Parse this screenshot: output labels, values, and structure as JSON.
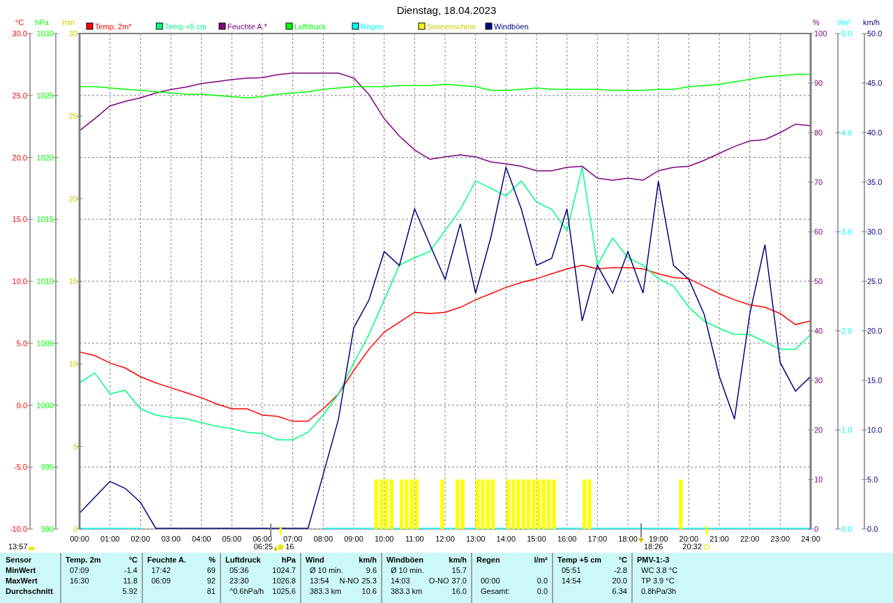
{
  "title": "Dienstag, 18.04.2023",
  "plots": [
    {
      "chart_data": {
        "type": "line",
        "ylabel": "°C",
        "xlim": [
          0,
          1440
        ],
        "ylim": [
          -10,
          30
        ],
        "x": [
          0,
          30,
          60,
          90,
          120,
          150,
          180,
          210,
          240,
          270,
          300,
          330,
          360,
          390,
          420,
          450,
          480,
          510,
          540,
          570,
          600,
          630,
          660,
          690,
          720,
          750,
          780,
          810,
          840,
          870,
          900,
          930,
          960,
          990,
          1020,
          1050,
          1080,
          1110,
          1140,
          1170,
          1200,
          1230,
          1260,
          1290,
          1320,
          1350,
          1380,
          1410,
          1440
        ],
        "xticks": [
          {
            "value": 0,
            "label": "00:00"
          },
          {
            "value": 60,
            "label": "01:00"
          },
          {
            "value": 120,
            "label": "02:00"
          },
          {
            "value": 180,
            "label": "03:00"
          },
          {
            "value": 240,
            "label": "04:00"
          },
          {
            "value": 300,
            "label": "05:00"
          },
          {
            "value": 360,
            "label": "06:00"
          },
          {
            "value": 420,
            "label": "07:00"
          },
          {
            "value": 480,
            "label": "08:00"
          },
          {
            "value": 540,
            "label": "09:00"
          },
          {
            "value": 600,
            "label": "10:00"
          },
          {
            "value": 660,
            "label": "11:00"
          },
          {
            "value": 720,
            "label": "12:00"
          },
          {
            "value": 780,
            "label": "13:00"
          },
          {
            "value": 840,
            "label": "14:00"
          },
          {
            "value": 900,
            "label": "15:00"
          },
          {
            "value": 960,
            "label": "16:00"
          },
          {
            "value": 1020,
            "label": "17:00"
          },
          {
            "value": 1080,
            "label": "18:00"
          },
          {
            "value": 1140,
            "label": "19:00"
          },
          {
            "value": 1200,
            "label": "20:00"
          },
          {
            "value": 1260,
            "label": "21:00"
          },
          {
            "value": 1320,
            "label": "22:00"
          },
          {
            "value": 1380,
            "label": "23:00"
          },
          {
            "value": 1440,
            "label": "24:00"
          }
        ],
        "yticks": [
          {
            "value": 30,
            "label": "30.0"
          },
          {
            "value": 25,
            "label": "25.0"
          },
          {
            "value": 20,
            "label": "20.0"
          },
          {
            "value": 15,
            "label": "15.0"
          },
          {
            "value": 10,
            "label": "10.0"
          },
          {
            "value": 5,
            "label": "5.0"
          },
          {
            "value": 0,
            "label": "0.0"
          },
          {
            "value": -5,
            "label": "-5.0"
          },
          {
            "value": -10,
            "label": "-10.0"
          }
        ],
        "series": [
          {
            "name": "Temp. 2m*",
            "color": "#ff0000",
            "values": [
              4.3,
              4.0,
              3.4,
              3.0,
              2.3,
              1.8,
              1.4,
              1.0,
              0.6,
              0.1,
              -0.3,
              -0.3,
              -0.8,
              -0.9,
              -1.3,
              -1.3,
              -0.3,
              0.9,
              2.8,
              4.5,
              5.9,
              6.7,
              7.5,
              7.4,
              7.5,
              7.9,
              8.5,
              9.0,
              9.5,
              9.9,
              10.2,
              10.6,
              11.0,
              11.3,
              11.0,
              11.1,
              11.1,
              11.0,
              10.6,
              10.3,
              10.2,
              9.6,
              9.0,
              8.5,
              8.1,
              7.9,
              7.4,
              6.5,
              6.8
            ]
          },
          {
            "name": "Temp +5 cm",
            "color": "#00ff80",
            "values": [
              1.8,
              2.6,
              0.9,
              1.2,
              -0.3,
              -0.8,
              -1.0,
              -1.1,
              -1.4,
              -1.7,
              -1.9,
              -2.2,
              -2.3,
              -2.8,
              -2.8,
              -2.2,
              -0.8,
              0.9,
              3.4,
              5.7,
              8.5,
              11.3,
              11.9,
              12.4,
              14.1,
              15.8,
              18.1,
              17.5,
              16.9,
              18.1,
              16.4,
              15.8,
              14.1,
              19.2,
              11.3,
              13.5,
              11.9,
              11.3,
              10.2,
              9.6,
              7.9,
              6.8,
              6.2,
              5.7,
              5.7,
              5.1,
              4.5,
              4.5,
              5.7
            ]
          }
        ]
      }
    },
    {
      "chart_data": {
        "type": "line",
        "ylabel": "%",
        "xlim": [
          0,
          1440
        ],
        "ylim": [
          0,
          100
        ],
        "x": [
          0,
          30,
          60,
          90,
          120,
          150,
          180,
          210,
          240,
          270,
          300,
          330,
          360,
          390,
          420,
          450,
          480,
          510,
          540,
          570,
          600,
          630,
          660,
          690,
          720,
          750,
          780,
          810,
          840,
          870,
          900,
          930,
          960,
          990,
          1020,
          1050,
          1080,
          1110,
          1140,
          1170,
          1200,
          1230,
          1260,
          1290,
          1320,
          1350,
          1380,
          1410,
          1440
        ],
        "yticks": [
          {
            "value": 100,
            "label": "100"
          },
          {
            "value": 90,
            "label": "90"
          },
          {
            "value": 80,
            "label": "80"
          },
          {
            "value": 70,
            "label": "70"
          },
          {
            "value": 60,
            "label": "60"
          },
          {
            "value": 50,
            "label": "50"
          },
          {
            "value": 40,
            "label": "40"
          },
          {
            "value": 30,
            "label": "30"
          },
          {
            "value": 20,
            "label": "20"
          },
          {
            "value": 10,
            "label": "10"
          },
          {
            "value": 0,
            "label": "0"
          }
        ],
        "series": [
          {
            "name": "Feuchte A.*",
            "color": "#800080",
            "values": [
              80.4,
              82.8,
              85.4,
              86.3,
              87.0,
              88.0,
              88.7,
              89.2,
              89.9,
              90.3,
              90.7,
              91.0,
              91.1,
              91.7,
              92.0,
              92.0,
              92.0,
              92.0,
              91.0,
              87.7,
              82.8,
              79.3,
              76.5,
              74.6,
              75.1,
              75.5,
              75.1,
              74.1,
              73.7,
              73.2,
              72.3,
              72.3,
              73.0,
              73.2,
              70.8,
              70.4,
              70.8,
              70.4,
              72.3,
              73.0,
              73.2,
              74.4,
              75.8,
              77.2,
              78.3,
              78.6,
              80.0,
              81.7,
              81.4
            ]
          }
        ]
      }
    },
    {
      "chart_data": {
        "type": "line",
        "ylabel": "hPa",
        "xlim": [
          0,
          1440
        ],
        "ylim": [
          990,
          1030
        ],
        "x": [
          0,
          30,
          60,
          90,
          120,
          150,
          180,
          210,
          240,
          270,
          300,
          330,
          360,
          390,
          420,
          450,
          480,
          510,
          540,
          570,
          600,
          630,
          660,
          690,
          720,
          750,
          780,
          810,
          840,
          870,
          900,
          930,
          960,
          990,
          1020,
          1050,
          1080,
          1110,
          1140,
          1170,
          1200,
          1230,
          1260,
          1290,
          1320,
          1350,
          1380,
          1410,
          1440
        ],
        "yticks": [
          {
            "value": 1030,
            "label": "1030"
          },
          {
            "value": 1025,
            "label": "1025"
          },
          {
            "value": 1020,
            "label": "1020"
          },
          {
            "value": 1015,
            "label": "1015"
          },
          {
            "value": 1010,
            "label": "1010"
          },
          {
            "value": 1005,
            "label": "1005"
          },
          {
            "value": 1000,
            "label": "1000"
          },
          {
            "value": 995,
            "label": "995"
          },
          {
            "value": 990,
            "label": "990"
          }
        ],
        "series": [
          {
            "name": "Luftdruck",
            "color": "#00ff00",
            "values": [
              1025.7,
              1025.7,
              1025.6,
              1025.5,
              1025.4,
              1025.3,
              1025.2,
              1025.1,
              1025.1,
              1025.0,
              1024.9,
              1024.8,
              1024.9,
              1025.1,
              1025.2,
              1025.3,
              1025.5,
              1025.6,
              1025.7,
              1025.7,
              1025.7,
              1025.8,
              1025.8,
              1025.8,
              1025.9,
              1025.8,
              1025.7,
              1025.4,
              1025.4,
              1025.5,
              1025.6,
              1025.5,
              1025.5,
              1025.5,
              1025.5,
              1025.4,
              1025.4,
              1025.4,
              1025.5,
              1025.5,
              1025.7,
              1025.8,
              1025.9,
              1026.1,
              1026.3,
              1026.5,
              1026.6,
              1026.7,
              1026.7
            ]
          }
        ]
      }
    },
    {
      "chart_data": {
        "type": "line",
        "ylabel": "l/m²",
        "xlim": [
          0,
          1440
        ],
        "ylim": [
          0,
          5
        ],
        "x": [
          0,
          30,
          60,
          90,
          120,
          480,
          510,
          540,
          570,
          600,
          630,
          660,
          690,
          720,
          750,
          780,
          810,
          840,
          870,
          900,
          930,
          960,
          990,
          1020,
          1050,
          1080,
          1110,
          1140,
          1170,
          1200,
          1230,
          1260,
          1290,
          1320,
          1350,
          1380,
          1410,
          1440
        ],
        "yticks": [
          {
            "value": 5,
            "label": "5.0"
          },
          {
            "value": 4,
            "label": "4.0"
          },
          {
            "value": 3,
            "label": "3.0"
          },
          {
            "value": 2,
            "label": "2.0"
          },
          {
            "value": 1,
            "label": "1.0"
          },
          {
            "value": 0,
            "label": "0.0"
          }
        ],
        "series": [
          {
            "name": "Regen",
            "color": "#00ffff",
            "values": [
              0,
              0,
              0,
              0,
              0,
              0,
              0,
              0,
              0,
              0,
              0,
              0,
              0,
              0,
              0,
              0,
              0,
              0,
              0,
              0,
              0,
              0,
              0,
              0,
              0,
              0,
              0,
              0,
              0,
              0,
              0,
              0,
              0,
              0,
              0,
              0,
              0,
              0
            ]
          }
        ]
      }
    },
    {
      "chart_data": {
        "type": "bar",
        "ylabel": "min",
        "xlim": [
          0,
          1440
        ],
        "ylim": [
          0,
          30
        ],
        "x": [
          580,
          590,
          600,
          610,
          630,
          640,
          650,
          660,
          710,
          740,
          750,
          780,
          790,
          800,
          810,
          840,
          850,
          860,
          870,
          880,
          890,
          900,
          910,
          920,
          930,
          990,
          1000,
          1180
        ],
        "yticks": [
          {
            "value": 30,
            "label": "30"
          },
          {
            "value": 25,
            "label": "25"
          },
          {
            "value": 20,
            "label": "20"
          },
          {
            "value": 15,
            "label": "15"
          },
          {
            "value": 10,
            "label": "10"
          },
          {
            "value": 5,
            "label": "5"
          },
          {
            "value": 0,
            "label": "0"
          }
        ],
        "series": [
          {
            "name": "Sonnenschein",
            "color": "#ffff00",
            "values": [
              3,
              3,
              3,
              3,
              3,
              3,
              3,
              3,
              3,
              3,
              3,
              3,
              3,
              3,
              3,
              3,
              3,
              3,
              3,
              3,
              3,
              3,
              3,
              3,
              3,
              3,
              3,
              3
            ]
          }
        ]
      }
    },
    {
      "chart_data": {
        "type": "line",
        "ylabel": "km/h",
        "xlim": [
          0,
          1440
        ],
        "ylim": [
          0,
          50
        ],
        "x": [
          0,
          30,
          60,
          90,
          120,
          150,
          180,
          210,
          240,
          270,
          300,
          330,
          360,
          390,
          420,
          450,
          480,
          510,
          540,
          570,
          600,
          630,
          660,
          690,
          720,
          750,
          780,
          810,
          840,
          870,
          900,
          930,
          960,
          990,
          1020,
          1050,
          1080,
          1110,
          1140,
          1170,
          1200,
          1230,
          1260,
          1290,
          1320,
          1350,
          1380,
          1410,
          1440
        ],
        "yticks": [
          {
            "value": 50,
            "label": "50.0"
          },
          {
            "value": 45,
            "label": "45.0"
          },
          {
            "value": 40,
            "label": "40.0"
          },
          {
            "value": 35,
            "label": "35.0"
          },
          {
            "value": 30,
            "label": "30.0"
          },
          {
            "value": 25,
            "label": "25.0"
          },
          {
            "value": 20,
            "label": "20.0"
          },
          {
            "value": 15,
            "label": "15.0"
          },
          {
            "value": 10,
            "label": "10.0"
          },
          {
            "value": 5,
            "label": "5.0"
          },
          {
            "value": 0,
            "label": "0.0"
          }
        ],
        "series": [
          {
            "name": "Windböen",
            "color": "#000080",
            "values": [
              1.6,
              3.2,
              4.8,
              4.1,
              2.7,
              0,
              0,
              0,
              0,
              0,
              0,
              0,
              0,
              0,
              0,
              0,
              5.5,
              11.1,
              20.3,
              23.1,
              28.0,
              26.6,
              32.3,
              28.7,
              25.2,
              30.8,
              23.8,
              29.4,
              36.5,
              32.3,
              26.6,
              27.3,
              32.3,
              21.0,
              26.6,
              23.8,
              28.0,
              23.8,
              35.1,
              26.6,
              25.2,
              21.7,
              15.4,
              11.1,
              21.7,
              28.7,
              16.8,
              13.9,
              15.4
            ]
          }
        ]
      }
    }
  ],
  "markers": [
    {
      "kind": "sunshine_total",
      "label": "13:57"
    },
    {
      "kind": "sunrise",
      "label": "06:25"
    },
    {
      "kind": "sun",
      "label": "16"
    },
    {
      "kind": "sunset",
      "label": "18:26"
    },
    {
      "kind": "moon",
      "label": "20:32"
    }
  ],
  "table": {
    "header": "Sensor",
    "row_labels": [
      "MinWert",
      "MaxWert",
      "Durchschnitt"
    ],
    "columns": [
      {
        "title": "Temp. 2m",
        "unit": "°C",
        "rows": [
          [
            "07:09",
            "-1.4"
          ],
          [
            "16:30",
            "11.8"
          ],
          [
            null,
            "5.92"
          ]
        ]
      },
      {
        "title": "Feuchte A.",
        "unit": "%",
        "rows": [
          [
            "17:42",
            "69"
          ],
          [
            "06:09",
            "92"
          ],
          [
            null,
            "81"
          ]
        ]
      },
      {
        "title": "Luftdruck",
        "unit": "hPa",
        "rows": [
          [
            "05:36",
            "1024.7"
          ],
          [
            "23:30",
            "1026.8"
          ],
          [
            "^0.6hPa/h",
            "1025.6"
          ]
        ]
      },
      {
        "title": "Wind",
        "unit": "km/h",
        "rows": [
          [
            "Ø 10 min.",
            "9.6"
          ],
          [
            "13:54",
            "N-NO",
            "25.3"
          ],
          [
            "383.3 km",
            "10.6"
          ]
        ]
      },
      {
        "title": "Windböen",
        "unit": "km/h",
        "rows": [
          [
            "Ø 10 min.",
            "15.7"
          ],
          [
            "14:03",
            "O-NO",
            "37.0"
          ],
          [
            "383.3 km",
            "16.0"
          ]
        ]
      },
      {
        "title": "Regen",
        "unit": "l/m²",
        "rows": [
          null,
          [
            "00:00",
            "0.0"
          ],
          [
            "Gesamt:",
            "0.0"
          ]
        ]
      },
      {
        "title": "Temp +5 cm",
        "unit": "°C",
        "rows": [
          [
            "05:51",
            "-2.8"
          ],
          [
            "14:54",
            "20.0"
          ],
          [
            null,
            "6.34"
          ]
        ]
      },
      {
        "title": "PMV-1:-3",
        "rows": [
          [
            "WC 3.8 °C"
          ],
          [
            "TP 3.9 °C"
          ],
          [
            "0.8hPa/3h"
          ]
        ]
      }
    ]
  }
}
